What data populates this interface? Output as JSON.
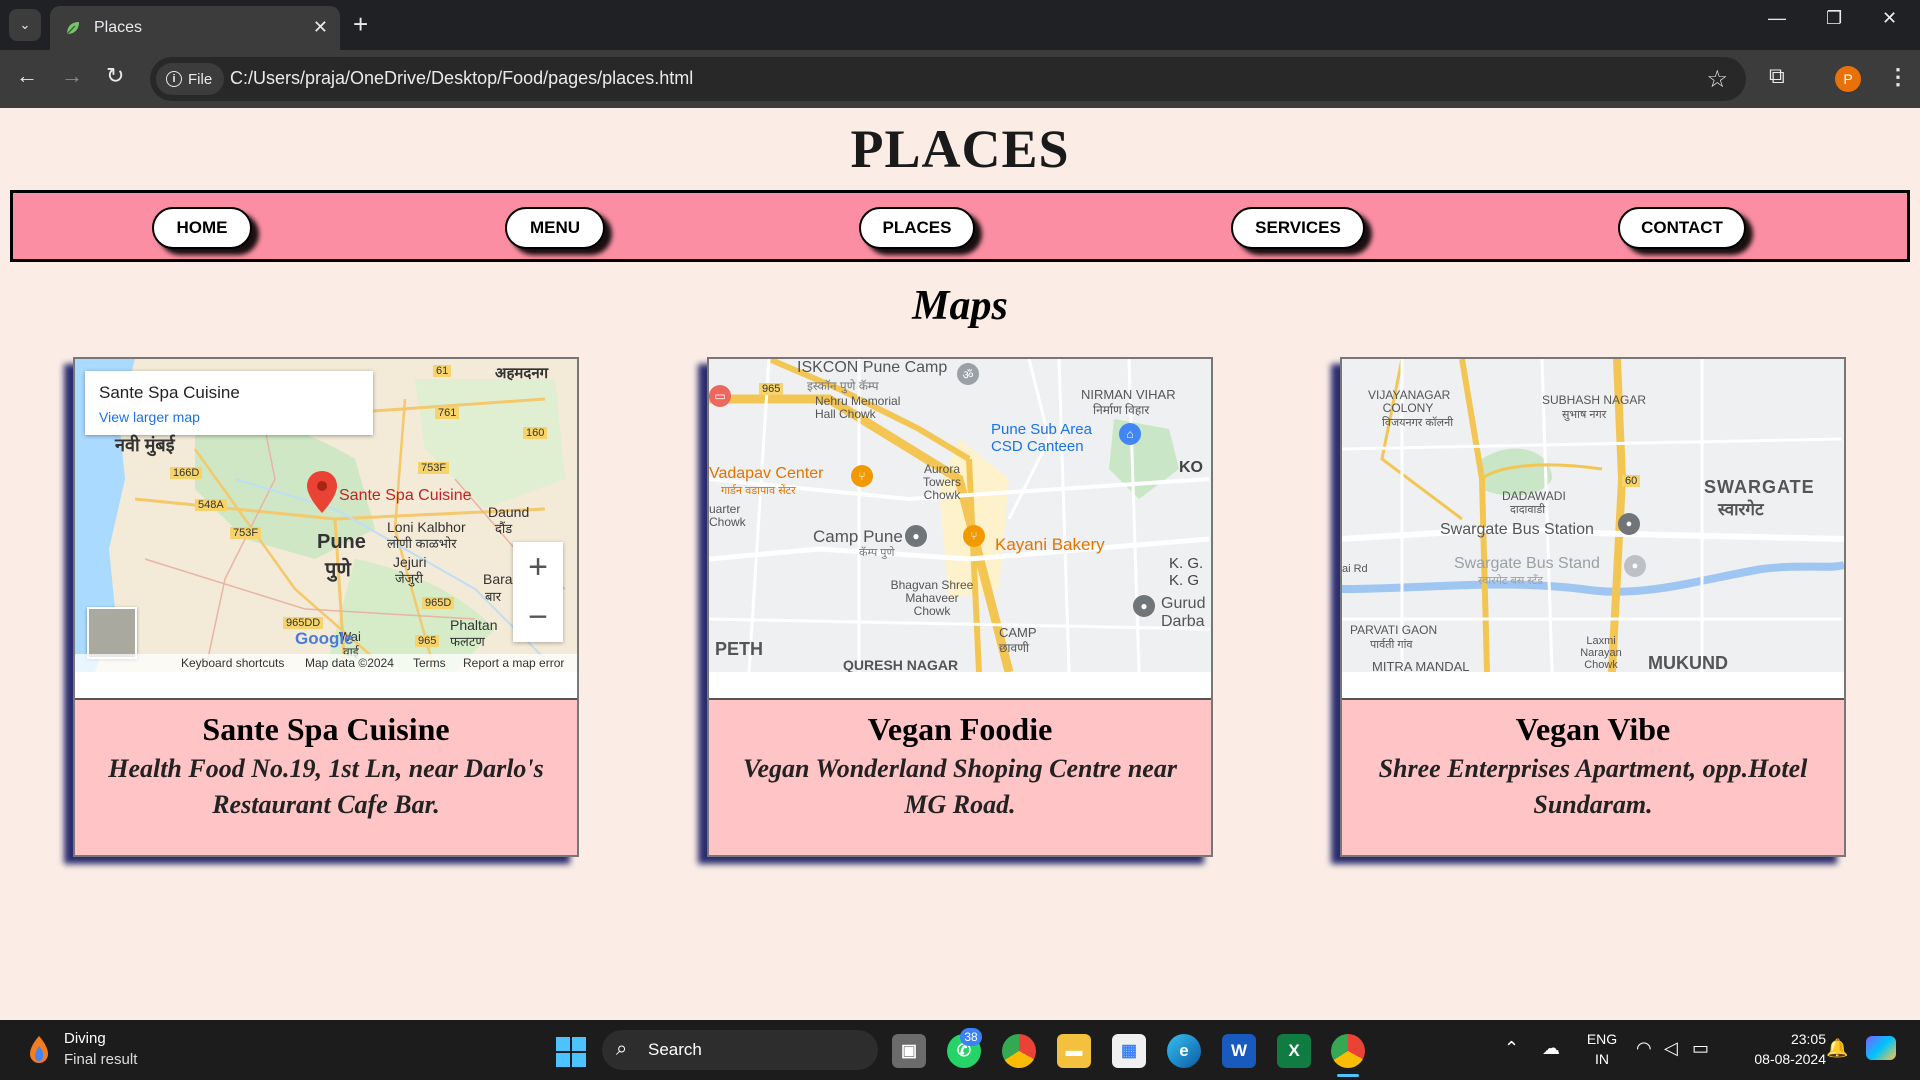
{
  "browser": {
    "tab_title": "Places",
    "url_scheme_label": "File",
    "url": "C:/Users/praja/OneDrive/Desktop/Food/pages/places.html",
    "profile_initial": "P"
  },
  "page": {
    "title": "PLACES",
    "nav": [
      "HOME",
      "MENU",
      "PLACES",
      "SERVICES",
      "CONTACT"
    ],
    "section_title": "Maps",
    "cards": [
      {
        "name": "Sante Spa Cuisine",
        "address": "Health Food No.19, 1st Ln, near Darlo's Restaurant Cafe Bar.",
        "map": {
          "info_title": "Sante Spa Cuisine",
          "info_link": "View larger map",
          "marker_label": "Sante Spa Cuisine",
          "labels": [
            "नवी मुंबई",
            "Pune",
            "पुणे",
            "Loni Kalbhor",
            "लोणी काळभोर",
            "Jejuri",
            "जेजुरी",
            "Daund",
            "दौंड",
            "Phaltan",
            "फलटण",
            "Wai",
            "वाई",
            "Bara",
            "बार",
            "अहमदनग"
          ],
          "roads": [
            "61",
            "761",
            "160",
            "166D",
            "753F",
            "548A",
            "753F",
            "965D",
            "965DD",
            "965"
          ],
          "attribution": [
            "Keyboard shortcuts",
            "Map data ©2024",
            "Terms",
            "Report a map error"
          ],
          "logo": "Google"
        }
      },
      {
        "name": "Vegan Foodie",
        "address": "Vegan Wonderland Shoping Centre near MG Road.",
        "map": {
          "labels": [
            "ISKCON Pune Camp",
            "इस्कॉन पुणे कॅम्प",
            "Nehru Memorial Hall Chowk",
            "NIRMAN VIHAR",
            "निर्माण विहार",
            "Pune Sub Area CSD Canteen",
            "Vadapav Center",
            "गार्डन वडापाव सेंटर",
            "Aurora Towers Chowk",
            "KO",
            "uarter Chowk",
            "Camp Pune",
            "कॅम्प पुणे",
            "Kayani Bakery",
            "K. G. K. G",
            "Bhagvan Shree Mahaveer Chowk",
            "Gurud Darba",
            "CAMP",
            "छावणी",
            "PETH",
            "QURESH NAGAR"
          ],
          "roads": [
            "965"
          ]
        }
      },
      {
        "name": "Vegan Vibe",
        "address": "Shree Enterprises Apartment, opp.Hotel Sundaram.",
        "map": {
          "labels": [
            "VIJAYANAGAR COLONY",
            "विजयनगर कॉलनी",
            "SUBHASH NAGAR",
            "सुभाष नगर",
            "DADAWADI",
            "दादावाडी",
            "SWARGATE",
            "स्वारगेट",
            "Swargate Bus Station",
            "Swargate Bus Stand",
            "स्वारगेट बस स्टँड",
            "ai Rd",
            "PARVATI GAON",
            "पार्वती गांव",
            "Laxmi Narayan Chowk",
            "MITRA MANDAL",
            "MUKUND"
          ],
          "roads": [
            "60"
          ]
        }
      }
    ]
  },
  "taskbar": {
    "weather_title": "Diving",
    "weather_sub": "Final result",
    "search": "Search",
    "whatsapp_badge": "38",
    "lang1": "ENG",
    "lang2": "IN",
    "time": "23:05",
    "date": "08-08-2024"
  }
}
